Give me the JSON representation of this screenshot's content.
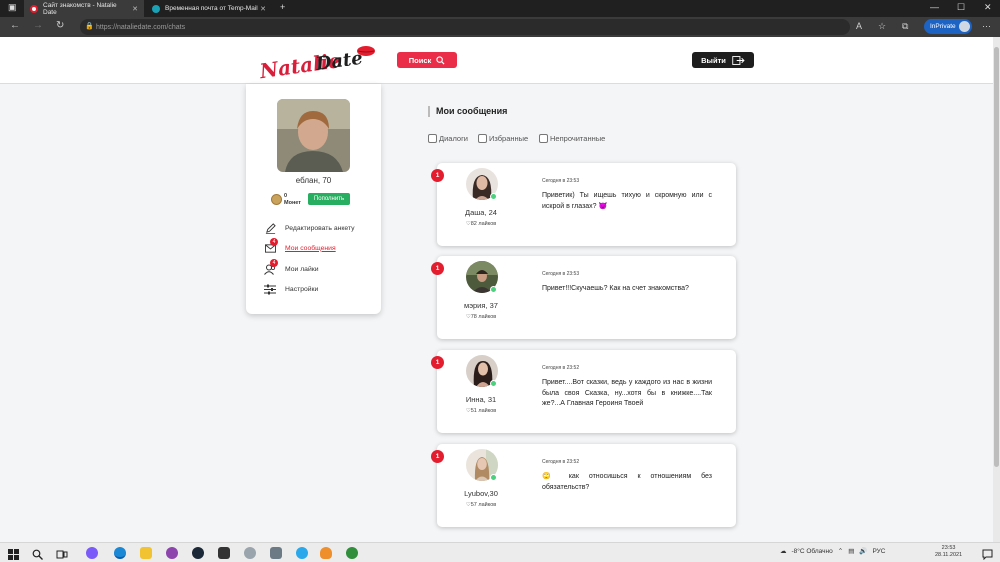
{
  "browser": {
    "tabs": [
      {
        "title": "Сайт знакомств - Natalie Date"
      },
      {
        "title": "Временная почта от Temp-Mail"
      }
    ],
    "url": "https://nataliedate.com/chats",
    "inprivate_label": "InPrivate"
  },
  "header": {
    "logo_text": "NatalieDate",
    "search_label": "Поиск",
    "logout_label": "Выйти"
  },
  "profile": {
    "name_age": "еблан, 70",
    "coins": "0",
    "coins_label": "Монет",
    "topup_label": "Пополнить",
    "menu": [
      {
        "label": "Редактировать анкету",
        "icon": "pencil-icon"
      },
      {
        "label": "Мои сообщения",
        "icon": "envelope-icon",
        "badge": "4"
      },
      {
        "label": "Мои лайки",
        "icon": "users-icon",
        "badge": "4"
      },
      {
        "label": "Настройки",
        "icon": "sliders-icon"
      }
    ]
  },
  "messages": {
    "title": "Мои сообщения",
    "filters": [
      "Диалоги",
      "Избранные",
      "Непрочитанные"
    ],
    "items": [
      {
        "badge": "1",
        "name": "Даша, 24",
        "likes": "82 лайков",
        "time": "Сегодня в 23:53",
        "text": "Приветик) Ты ищешь тихую и скромную или с искрой в глазах? 😈"
      },
      {
        "badge": "1",
        "name": "мэрия, 37",
        "likes": "78 лайков",
        "time": "Сегодня в 23:53",
        "text": "Привет!!!Скучаешь? Как на счет знакомства?"
      },
      {
        "badge": "1",
        "name": "Инна, 31",
        "likes": "51 лайков",
        "time": "Сегодня в 23:52",
        "text": "Привет....Вот сказки, ведь у каждого из нас в жизни была своя Сказка, ну...хотя бы в книжке....Так же?...А Главная Героиня Твоей"
      },
      {
        "badge": "1",
        "name": "Lyubov,30",
        "likes": "57 лайков",
        "time": "Сегодня в 23:52",
        "text": "🙄 как относишься к отношениям без обязательств?"
      }
    ]
  },
  "taskbar": {
    "weather": "-8°C Облачно",
    "lang": "РУС",
    "time": "23:53",
    "date": "28.11.2021"
  },
  "colors": {
    "accent_red": "#ea2d48",
    "badge_red": "#e31d2d",
    "topup_green": "#27ae60",
    "online_green": "#4cd07d"
  }
}
